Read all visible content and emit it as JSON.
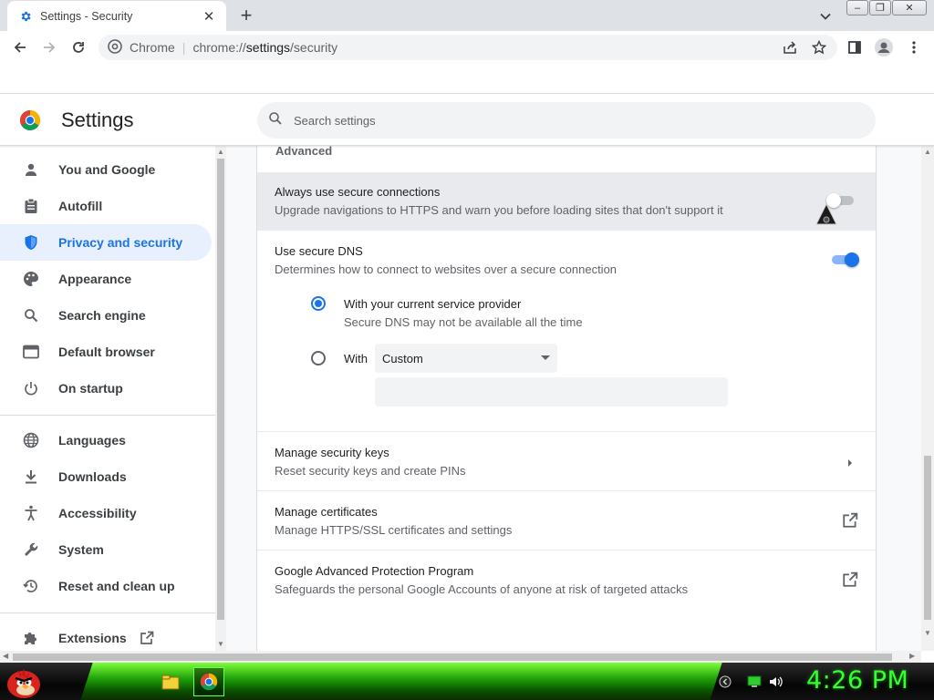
{
  "window": {
    "tab_title": "Settings - Security",
    "new_tab_symbol": "+",
    "close_tab_symbol": "✕",
    "controls": {
      "minimize": "–",
      "restore": "❐",
      "close": "✕"
    }
  },
  "omnibox": {
    "site_label": "Chrome",
    "separator": "|",
    "url_scheme": "chrome://",
    "url_host": "settings",
    "url_path": "/security"
  },
  "settings": {
    "title": "Settings",
    "search_placeholder": "Search settings"
  },
  "sidebar": {
    "items": [
      {
        "label": "You and Google",
        "icon": "person-icon",
        "active": false
      },
      {
        "label": "Autofill",
        "icon": "clipboard-icon",
        "active": false
      },
      {
        "label": "Privacy and security",
        "icon": "shield-icon",
        "active": true
      },
      {
        "label": "Appearance",
        "icon": "palette-icon",
        "active": false
      },
      {
        "label": "Search engine",
        "icon": "search-icon",
        "active": false
      },
      {
        "label": "Default browser",
        "icon": "browser-icon",
        "active": false
      },
      {
        "label": "On startup",
        "icon": "power-icon",
        "active": false
      },
      {
        "label": "Languages",
        "icon": "globe-icon",
        "active": false
      },
      {
        "label": "Downloads",
        "icon": "download-icon",
        "active": false
      },
      {
        "label": "Accessibility",
        "icon": "accessibility-icon",
        "active": false
      },
      {
        "label": "System",
        "icon": "wrench-icon",
        "active": false
      },
      {
        "label": "Reset and clean up",
        "icon": "history-icon",
        "active": false
      },
      {
        "label": "Extensions",
        "icon": "puzzle-icon",
        "active": false
      }
    ]
  },
  "main": {
    "section_header": "Advanced",
    "secure_connections": {
      "title": "Always use secure connections",
      "description": "Upgrade navigations to HTTPS and warn you before loading sites that don't support it",
      "enabled": false
    },
    "secure_dns": {
      "title": "Use secure DNS",
      "description": "Determines how to connect to websites over a secure connection",
      "enabled": true,
      "option_current": {
        "title": "With your current service provider",
        "description": "Secure DNS may not be available all the time",
        "selected": true
      },
      "option_custom": {
        "label": "With",
        "select_value": "Custom",
        "selected": false,
        "input_value": ""
      }
    },
    "security_keys": {
      "title": "Manage security keys",
      "description": "Reset security keys and create PINs"
    },
    "certificates": {
      "title": "Manage certificates",
      "description": "Manage HTTPS/SSL certificates and settings"
    },
    "advanced_protection": {
      "title": "Google Advanced Protection Program",
      "description": "Safeguards the personal Google Accounts of anyone at risk of targeted attacks"
    }
  },
  "taskbar": {
    "clock": "4:26 PM"
  },
  "colors": {
    "accent_blue": "#1a73e8",
    "active_nav_bg": "#e8f0fe",
    "taskbar_green": "#1c9c06",
    "clock_green": "#35ff2e"
  }
}
